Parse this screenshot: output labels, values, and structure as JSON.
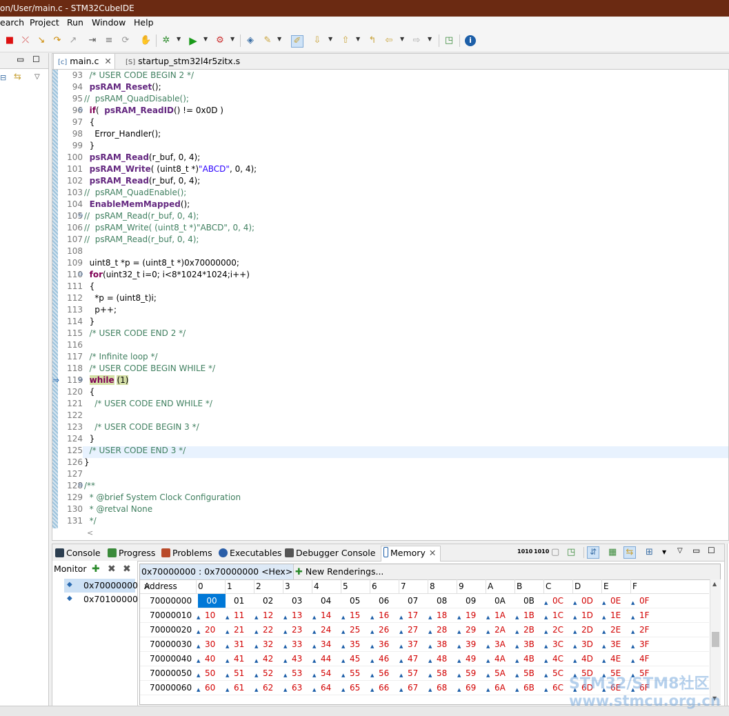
{
  "window": {
    "title": "on/User/main.c - STM32CubeIDE"
  },
  "menu": [
    "earch",
    "Project",
    "Run",
    "Window",
    "Help"
  ],
  "editor": {
    "tabs": [
      {
        "label": "main.c",
        "active": true
      },
      {
        "label": "startup_stm32l4r5zitx.s",
        "active": false
      }
    ],
    "lines": [
      {
        "n": "93",
        "t": "  /* USER CODE BEGIN 2 */",
        "c": "cm"
      },
      {
        "n": "94",
        "t": "  psRAM_Reset();",
        "c": "fnline"
      },
      {
        "n": "95",
        "t": "//  psRAM_QuadDisable();",
        "c": "cm"
      },
      {
        "n": "96",
        "t": "  if(  psRAM_ReadID() != 0x0D )",
        "c": "ifline",
        "fold": true
      },
      {
        "n": "97",
        "t": "  {",
        "c": ""
      },
      {
        "n": "98",
        "t": "    Error_Handler();",
        "c": ""
      },
      {
        "n": "99",
        "t": "  }",
        "c": ""
      },
      {
        "n": "100",
        "t": "  psRAM_Read(r_buf, 0, 4);",
        "c": "fnline"
      },
      {
        "n": "101",
        "t": "  psRAM_Write( (uint8_t *)\"ABCD\", 0, 4);",
        "c": "fnline"
      },
      {
        "n": "102",
        "t": "  psRAM_Read(r_buf, 0, 4);",
        "c": "fnline"
      },
      {
        "n": "103",
        "t": "//  psRAM_QuadEnable();",
        "c": "cm"
      },
      {
        "n": "104",
        "t": "  EnableMemMapped();",
        "c": "fnline"
      },
      {
        "n": "105",
        "t": "//  psRAM_Read(r_buf, 0, 4);",
        "c": "cm",
        "fold": true
      },
      {
        "n": "106",
        "t": "//  psRAM_Write( (uint8_t *)\"ABCD\", 0, 4);",
        "c": "cm"
      },
      {
        "n": "107",
        "t": "//  psRAM_Read(r_buf, 0, 4);",
        "c": "cm"
      },
      {
        "n": "108",
        "t": "",
        "c": ""
      },
      {
        "n": "109",
        "t": "  uint8_t *p = (uint8_t *)0x70000000;",
        "c": ""
      },
      {
        "n": "110",
        "t": "  for(uint32_t i=0; i<8*1024*1024;i++)",
        "c": "forline",
        "fold": true
      },
      {
        "n": "111",
        "t": "  {",
        "c": ""
      },
      {
        "n": "112",
        "t": "    *p = (uint8_t)i;",
        "c": ""
      },
      {
        "n": "113",
        "t": "    p++;",
        "c": ""
      },
      {
        "n": "114",
        "t": "  }",
        "c": ""
      },
      {
        "n": "115",
        "t": "  /* USER CODE END 2 */",
        "c": "cm"
      },
      {
        "n": "116",
        "t": "",
        "c": ""
      },
      {
        "n": "117",
        "t": "  /* Infinite loop */",
        "c": "cm"
      },
      {
        "n": "118",
        "t": "  /* USER CODE BEGIN WHILE */",
        "c": "cm"
      },
      {
        "n": "119",
        "t": "  while (1)",
        "c": "whileline",
        "fold": true
      },
      {
        "n": "120",
        "t": "  {",
        "c": ""
      },
      {
        "n": "121",
        "t": "    /* USER CODE END WHILE */",
        "c": "cm"
      },
      {
        "n": "122",
        "t": "",
        "c": ""
      },
      {
        "n": "123",
        "t": "    /* USER CODE BEGIN 3 */",
        "c": "cm"
      },
      {
        "n": "124",
        "t": "  }",
        "c": ""
      },
      {
        "n": "125",
        "t": "  /* USER CODE END 3 */",
        "c": "cm"
      },
      {
        "n": "126",
        "t": "}",
        "c": ""
      },
      {
        "n": "127",
        "t": "",
        "c": ""
      },
      {
        "n": "128",
        "t": "/**",
        "c": "cm",
        "fold": true
      },
      {
        "n": "129",
        "t": "  * @brief System Clock Configuration",
        "c": "cm"
      },
      {
        "n": "130",
        "t": "  * @retval None",
        "c": "cm"
      },
      {
        "n": "131",
        "t": "  */",
        "c": "cm"
      }
    ]
  },
  "bottom": {
    "tabs": [
      "Console",
      "Progress",
      "Problems",
      "Executables",
      "Debugger Console",
      "Memory"
    ],
    "monitor_label": "Monitor",
    "monitors": [
      "0x70000000",
      "0x70100000"
    ],
    "memtab_label": "0x70000000 : 0x70000000 <Hex>",
    "new_renderings": "New Renderings...",
    "header": [
      "Address",
      "0",
      "1",
      "2",
      "3",
      "4",
      "5",
      "6",
      "7",
      "8",
      "9",
      "A",
      "B",
      "C",
      "D",
      "E",
      "F"
    ],
    "rows": [
      {
        "addr": "70000000",
        "cells": [
          "00",
          "01",
          "02",
          "03",
          "04",
          "05",
          "06",
          "07",
          "08",
          "09",
          "0A",
          "0B",
          "0C",
          "0D",
          "0E",
          "0F"
        ]
      },
      {
        "addr": "70000010",
        "cells": [
          "10",
          "11",
          "12",
          "13",
          "14",
          "15",
          "16",
          "17",
          "18",
          "19",
          "1A",
          "1B",
          "1C",
          "1D",
          "1E",
          "1F"
        ]
      },
      {
        "addr": "70000020",
        "cells": [
          "20",
          "21",
          "22",
          "23",
          "24",
          "25",
          "26",
          "27",
          "28",
          "29",
          "2A",
          "2B",
          "2C",
          "2D",
          "2E",
          "2F"
        ]
      },
      {
        "addr": "70000030",
        "cells": [
          "30",
          "31",
          "32",
          "33",
          "34",
          "35",
          "36",
          "37",
          "38",
          "39",
          "3A",
          "3B",
          "3C",
          "3D",
          "3E",
          "3F"
        ]
      },
      {
        "addr": "70000040",
        "cells": [
          "40",
          "41",
          "42",
          "43",
          "44",
          "45",
          "46",
          "47",
          "48",
          "49",
          "4A",
          "4B",
          "4C",
          "4D",
          "4E",
          "4F"
        ]
      },
      {
        "addr": "70000050",
        "cells": [
          "50",
          "51",
          "52",
          "53",
          "54",
          "55",
          "56",
          "57",
          "58",
          "59",
          "5A",
          "5B",
          "5C",
          "5D",
          "5E",
          "5F"
        ]
      },
      {
        "addr": "70000060",
        "cells": [
          "60",
          "61",
          "62",
          "63",
          "64",
          "65",
          "66",
          "67",
          "68",
          "69",
          "6A",
          "6B",
          "6C",
          "6D",
          "6E",
          "6F"
        ]
      }
    ]
  },
  "watermark": {
    "line1": "STM32/STM8社区",
    "line2": "www.stmcu.org.cn"
  }
}
